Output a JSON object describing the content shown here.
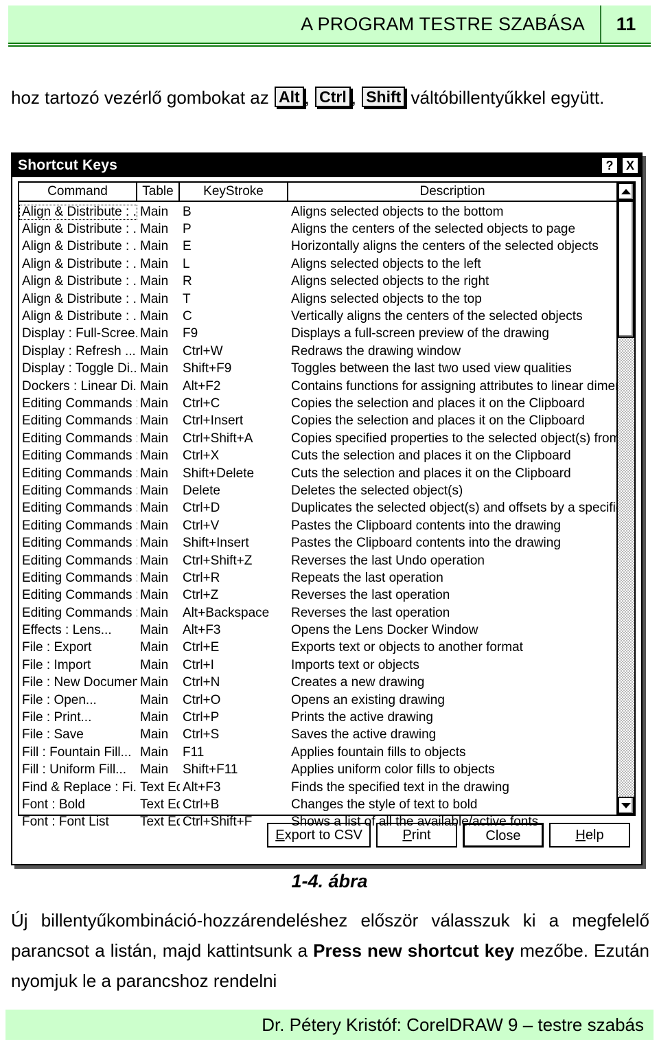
{
  "header": {
    "title": "A PROGRAM TESTRE SZABÁSA",
    "page_number": "11"
  },
  "intro": {
    "before": "hoz tartozó vezérlő gombokat az ",
    "key1": "Alt",
    "sep1": ", ",
    "key2": "Ctrl",
    "sep2": ", ",
    "key3": "Shift",
    "after": " váltóbillentyűkkel együtt."
  },
  "dialog": {
    "title": "Shortcut Keys",
    "help_button": "?",
    "close_button": "X",
    "columns": [
      "Command",
      "Table",
      "KeyStroke",
      "Description"
    ],
    "rows": [
      {
        "command": "Align & Distribute : ...",
        "table": "Main",
        "keystroke": "B",
        "description": "Aligns selected objects to the bottom"
      },
      {
        "command": "Align & Distribute : ...",
        "table": "Main",
        "keystroke": "P",
        "description": "Aligns the centers of the selected objects to page"
      },
      {
        "command": "Align & Distribute : ...",
        "table": "Main",
        "keystroke": "E",
        "description": "Horizontally aligns the centers of the selected objects"
      },
      {
        "command": "Align & Distribute : ...",
        "table": "Main",
        "keystroke": "L",
        "description": "Aligns selected objects to the left"
      },
      {
        "command": "Align & Distribute : ...",
        "table": "Main",
        "keystroke": "R",
        "description": "Aligns selected objects to the right"
      },
      {
        "command": "Align & Distribute : ...",
        "table": "Main",
        "keystroke": "T",
        "description": "Aligns selected objects to the top"
      },
      {
        "command": "Align & Distribute : ...",
        "table": "Main",
        "keystroke": "C",
        "description": "Vertically aligns the centers of the selected objects"
      },
      {
        "command": "Display : Full-Scree...",
        "table": "Main",
        "keystroke": "F9",
        "description": "Displays a full-screen preview of the drawing"
      },
      {
        "command": "Display : Refresh ...",
        "table": "Main",
        "keystroke": "Ctrl+W",
        "description": "Redraws the drawing window"
      },
      {
        "command": "Display : Toggle Di...",
        "table": "Main",
        "keystroke": "Shift+F9",
        "description": "Toggles between the last two used view qualities"
      },
      {
        "command": "Dockers : Linear Di...",
        "table": "Main",
        "keystroke": "Alt+F2",
        "description": "Contains functions for assigning attributes to linear dimension lines"
      },
      {
        "command": "Editing Commands :...",
        "table": "Main",
        "keystroke": "Ctrl+C",
        "description": "Copies the selection and places it on the Clipboard"
      },
      {
        "command": "Editing Commands :...",
        "table": "Main",
        "keystroke": "Ctrl+Insert",
        "description": "Copies the selection and places it on the Clipboard"
      },
      {
        "command": "Editing Commands :...",
        "table": "Main",
        "keystroke": "Ctrl+Shift+A",
        "description": "Copies specified properties to the selected object(s) from another object"
      },
      {
        "command": "Editing Commands :...",
        "table": "Main",
        "keystroke": "Ctrl+X",
        "description": "Cuts the selection and places it on the Clipboard"
      },
      {
        "command": "Editing Commands :...",
        "table": "Main",
        "keystroke": "Shift+Delete",
        "description": "Cuts the selection and places it on the Clipboard"
      },
      {
        "command": "Editing Commands :...",
        "table": "Main",
        "keystroke": "Delete",
        "description": "Deletes the selected object(s)"
      },
      {
        "command": "Editing Commands :...",
        "table": "Main",
        "keystroke": "Ctrl+D",
        "description": "Duplicates the selected object(s) and offsets by a specified amount"
      },
      {
        "command": "Editing Commands :...",
        "table": "Main",
        "keystroke": "Ctrl+V",
        "description": "Pastes the Clipboard contents into the drawing"
      },
      {
        "command": "Editing Commands :...",
        "table": "Main",
        "keystroke": "Shift+Insert",
        "description": "Pastes the Clipboard contents into the drawing"
      },
      {
        "command": "Editing Commands :...",
        "table": "Main",
        "keystroke": "Ctrl+Shift+Z",
        "description": "Reverses the last Undo operation"
      },
      {
        "command": "Editing Commands :...",
        "table": "Main",
        "keystroke": "Ctrl+R",
        "description": "Repeats the last operation"
      },
      {
        "command": "Editing Commands :...",
        "table": "Main",
        "keystroke": "Ctrl+Z",
        "description": "Reverses the last operation"
      },
      {
        "command": "Editing Commands :...",
        "table": "Main",
        "keystroke": "Alt+Backspace",
        "description": "Reverses the last operation"
      },
      {
        "command": "Effects : Lens...",
        "table": "Main",
        "keystroke": "Alt+F3",
        "description": "Opens the Lens Docker Window"
      },
      {
        "command": "File : Export",
        "table": "Main",
        "keystroke": "Ctrl+E",
        "description": "Exports text or objects to another format"
      },
      {
        "command": "File : Import",
        "table": "Main",
        "keystroke": "Ctrl+I",
        "description": "Imports text or objects"
      },
      {
        "command": "File : New Document",
        "table": "Main",
        "keystroke": "Ctrl+N",
        "description": "Creates a new drawing"
      },
      {
        "command": "File : Open...",
        "table": "Main",
        "keystroke": "Ctrl+O",
        "description": "Opens an existing drawing"
      },
      {
        "command": "File : Print...",
        "table": "Main",
        "keystroke": "Ctrl+P",
        "description": "Prints the active drawing"
      },
      {
        "command": "File : Save",
        "table": "Main",
        "keystroke": "Ctrl+S",
        "description": "Saves the active drawing"
      },
      {
        "command": "Fill : Fountain Fill...",
        "table": "Main",
        "keystroke": "F11",
        "description": "Applies fountain fills to objects"
      },
      {
        "command": "Fill : Uniform Fill...",
        "table": "Main",
        "keystroke": "Shift+F11",
        "description": "Applies uniform color fills to objects"
      },
      {
        "command": "Find & Replace : Fi...",
        "table": "Text Ed...",
        "keystroke": "Alt+F3",
        "description": "Finds the specified text in the drawing"
      },
      {
        "command": "Font : Bold",
        "table": "Text Ed...",
        "keystroke": "Ctrl+B",
        "description": "Changes the style of text to bold"
      },
      {
        "command": "Font : Font List",
        "table": "Text Ed...",
        "keystroke": "Ctrl+Shift+F",
        "description": "Shows a list of all the available/active fonts"
      }
    ],
    "buttons": [
      {
        "mnemonic": "E",
        "rest": "xport to CSV",
        "default": false
      },
      {
        "mnemonic": "P",
        "rest": "rint",
        "default": false
      },
      {
        "mnemonic": "",
        "rest": "Close",
        "default": true
      },
      {
        "mnemonic": "H",
        "rest": "elp",
        "default": false
      }
    ],
    "scrollbar": {
      "up_arrow": "scroll-up-arrow",
      "down_arrow": "scroll-down-arrow"
    }
  },
  "figure": {
    "caption": "1-4. ábra"
  },
  "body": {
    "part1": "Új billentyűkombináció-hozzárendeléshez először válasszuk ki a megfelelő parancsot a listán, majd kattintsunk a ",
    "bold": "Press new shortcut key",
    "part2": " mezőbe. Ezután nyomjuk le a parancshoz rendelni"
  },
  "footer": {
    "text": "Dr. Pétery Kristóf: CorelDRAW 9 – testre szabás"
  },
  "colors": {
    "header_band": "#ccffcc",
    "header_rule": "#0e7a0e",
    "titlebar": "#000000"
  }
}
